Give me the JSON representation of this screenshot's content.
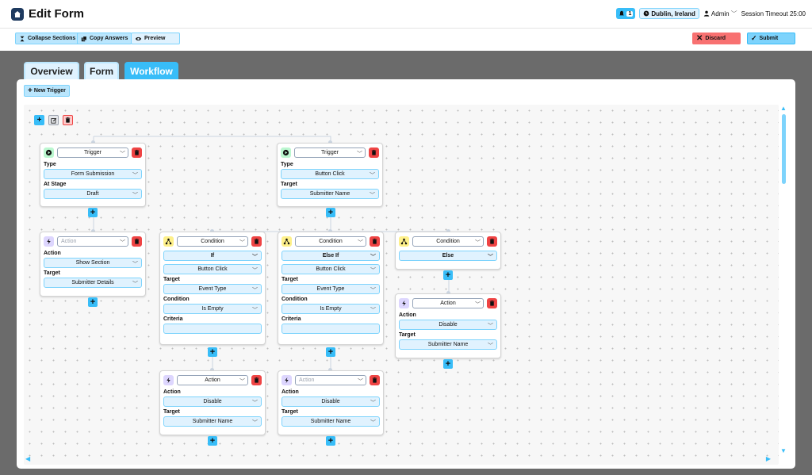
{
  "header": {
    "title": "Edit Form",
    "notification_count": "1",
    "location": "Dublin, Ireland",
    "user": "Admin",
    "session": "Session Timeout 25:00"
  },
  "toolbar": {
    "collapse": "Collapse Sections",
    "copy": "Copy Answers",
    "preview": "Preview",
    "discard": "Discard",
    "submit": "Submit"
  },
  "tabs": [
    "Overview",
    "Form",
    "Workflow"
  ],
  "new_trigger": "New Trigger",
  "labels": {
    "type": "Type",
    "at_stage": "At Stage",
    "target": "Target",
    "action": "Action",
    "condition": "Condition",
    "criteria": "Criteria"
  },
  "nodes": {
    "trigger1": {
      "head": "Trigger",
      "type": "Form Submission",
      "stage": "Draft"
    },
    "trigger2": {
      "head": "Trigger",
      "type": "Button Click",
      "target": "Submitter Name"
    },
    "action1": {
      "head_placeholder": "Action",
      "action": "Show Section",
      "target": "Submitter Details"
    },
    "cond_if": {
      "head": "Condition",
      "branch": "If",
      "event": "Button Click",
      "target": "Event Type",
      "condition": "Is Empty",
      "criteria": ""
    },
    "cond_elseif": {
      "head": "Condition",
      "branch": "Else If",
      "event": "Button Click",
      "target": "Event Type",
      "condition": "Is Empty",
      "criteria": ""
    },
    "cond_else": {
      "head": "Condition",
      "branch": "Else"
    },
    "action_else": {
      "head": "Action",
      "action": "Disable",
      "target": "Submitter Name"
    },
    "action_if": {
      "head": "Action",
      "action": "Disable",
      "target": "Submitter Name"
    },
    "action_elseif": {
      "head_placeholder": "Action",
      "action": "Disable",
      "target": "Submitter Name"
    }
  },
  "colors": {
    "accent": "#38bdf8",
    "danger": "#ef4444",
    "trigger": "#bbf7d0",
    "condition": "#fef08a",
    "action": "#ddd6fe"
  }
}
